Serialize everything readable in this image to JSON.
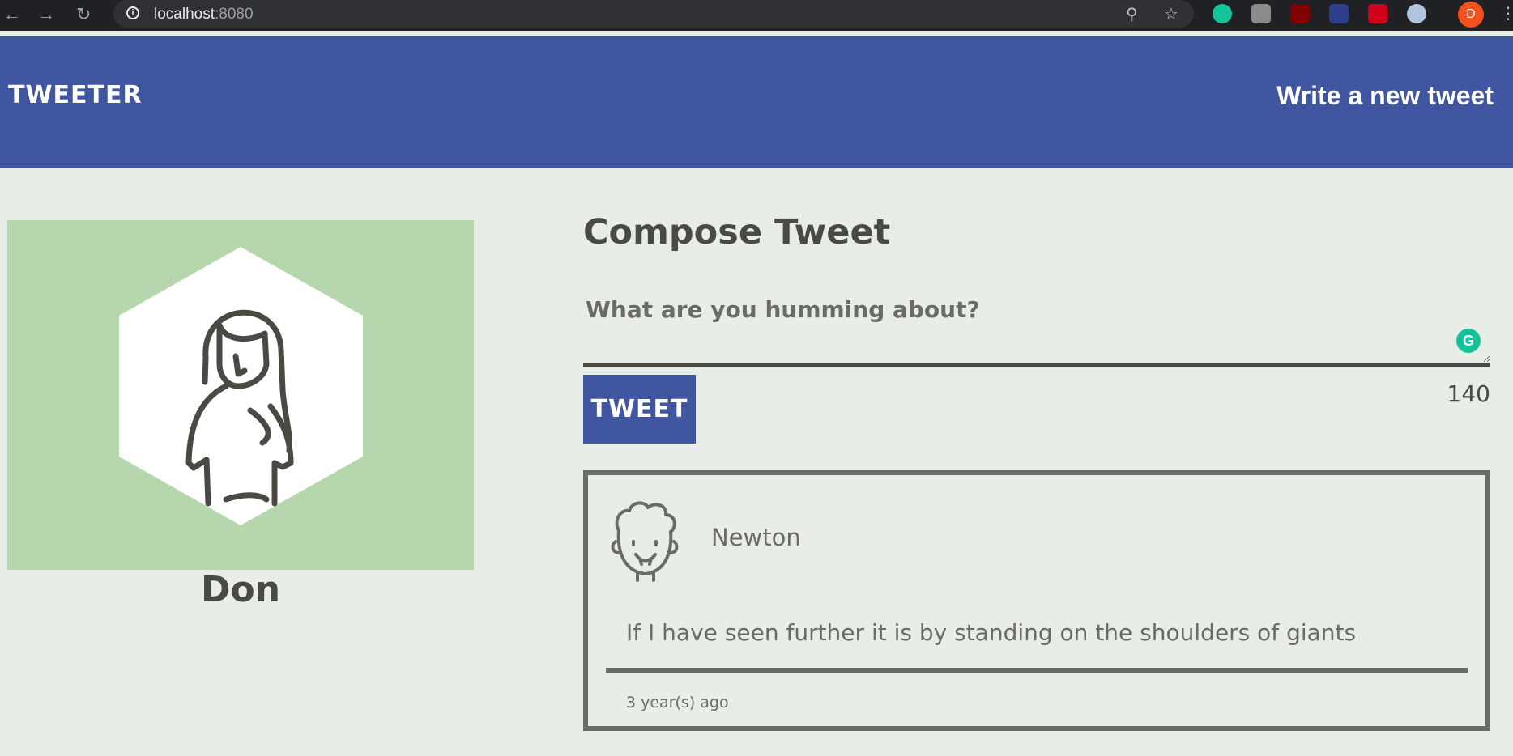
{
  "browser": {
    "url_host": "localhost",
    "url_port": ":8080",
    "profile_initial": "D"
  },
  "header": {
    "logo": "TWEETER",
    "write_link": "Write a new tweet",
    "background": "#4056a1"
  },
  "profile": {
    "name": "Don",
    "card_color": "#b6d6ae"
  },
  "compose": {
    "title": "Compose Tweet",
    "placeholder": "What are you humming about?",
    "button_label": "TWEET",
    "counter": "140"
  },
  "tweets": [
    {
      "author": "Newton",
      "text": "If I have seen further it is by standing on the shoulders of giants",
      "time": "3 year(s) ago"
    }
  ]
}
